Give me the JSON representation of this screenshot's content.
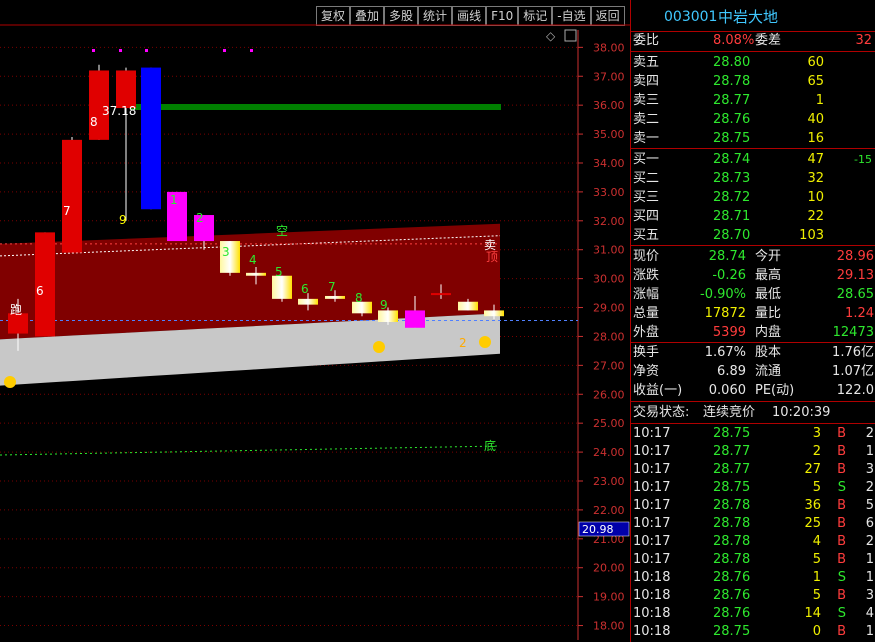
{
  "toolbar": [
    "复权",
    "叠加",
    "多股",
    "统计",
    "画线",
    "F10",
    "标记",
    "-自选",
    "返回"
  ],
  "stock": {
    "code": "003001",
    "name": "中岩大地"
  },
  "chart_data": {
    "type": "candlestick",
    "y_axis_ticks": [
      "38.00",
      "37.00",
      "36.00",
      "35.00",
      "34.00",
      "33.00",
      "32.00",
      "31.00",
      "30.00",
      "29.00",
      "28.00",
      "27.00",
      "26.00",
      "25.00",
      "24.00",
      "23.00",
      "22.00",
      "21.00",
      "20.00",
      "19.00",
      "18.00"
    ],
    "ylim": [
      17.5,
      38.6
    ],
    "candles": [
      {
        "o": 28.1,
        "h": 29.3,
        "l": 27.5,
        "c": 28.8,
        "color": "red"
      },
      {
        "o": 28.0,
        "h": 31.6,
        "l": 28.0,
        "c": 31.6,
        "color": "red"
      },
      {
        "o": 30.9,
        "h": 34.9,
        "l": 30.9,
        "c": 34.8,
        "color": "red"
      },
      {
        "o": 34.8,
        "h": 37.4,
        "l": 34.8,
        "c": 37.2,
        "color": "red"
      },
      {
        "o": 37.2,
        "h": 37.3,
        "l": 32.0,
        "c": 35.9,
        "color": "red"
      },
      {
        "o": 37.3,
        "h": 37.3,
        "l": 32.4,
        "c": 32.4,
        "color": "blue"
      },
      {
        "o": 33.0,
        "h": 33.0,
        "l": 31.3,
        "c": 31.3,
        "color": "magenta"
      },
      {
        "o": 32.2,
        "h": 32.2,
        "l": 31.0,
        "c": 31.3,
        "color": "magenta"
      },
      {
        "o": 31.3,
        "h": 31.3,
        "l": 30.1,
        "c": 30.2,
        "color": "yellow"
      },
      {
        "o": 30.2,
        "h": 30.4,
        "l": 29.8,
        "c": 30.1,
        "color": "yellow"
      },
      {
        "o": 30.1,
        "h": 30.1,
        "l": 29.2,
        "c": 29.3,
        "color": "yellow"
      },
      {
        "o": 29.3,
        "h": 29.5,
        "l": 28.9,
        "c": 29.1,
        "color": "yellow"
      },
      {
        "o": 29.3,
        "h": 29.6,
        "l": 29.2,
        "c": 29.4,
        "color": "yellow"
      },
      {
        "o": 29.2,
        "h": 29.2,
        "l": 28.7,
        "c": 28.8,
        "color": "yellow"
      },
      {
        "o": 28.9,
        "h": 29.0,
        "l": 28.4,
        "c": 28.5,
        "color": "yellow"
      },
      {
        "o": 28.3,
        "h": 29.4,
        "l": 28.3,
        "c": 28.9,
        "color": "magenta"
      },
      {
        "o": 29.5,
        "h": 29.8,
        "l": 29.3,
        "c": 29.5,
        "color": "red"
      },
      {
        "o": 29.2,
        "h": 29.3,
        "l": 28.9,
        "c": 28.9,
        "color": "yellow"
      },
      {
        "o": 28.9,
        "h": 29.1,
        "l": 28.6,
        "c": 28.7,
        "color": "yellow"
      }
    ],
    "annotations": [
      "跑",
      "6",
      "7",
      "8",
      "37.18",
      "9",
      "1",
      "2",
      "3",
      "4",
      "5",
      "6",
      "7",
      "8",
      "9",
      "空",
      "卖",
      "顶",
      "2",
      "底"
    ],
    "price_label": "20.98"
  },
  "quote": {
    "weibi_label": "委比",
    "weibi": "8.08%",
    "weicha_label": "委差",
    "weicha": "32",
    "sells": [
      {
        "label": "卖五",
        "price": "28.80",
        "vol": "60"
      },
      {
        "label": "卖四",
        "price": "28.78",
        "vol": "65"
      },
      {
        "label": "卖三",
        "price": "28.77",
        "vol": "1"
      },
      {
        "label": "卖二",
        "price": "28.76",
        "vol": "40"
      },
      {
        "label": "卖一",
        "price": "28.75",
        "vol": "16"
      }
    ],
    "buys": [
      {
        "label": "买一",
        "price": "28.74",
        "vol": "47",
        "chg": "-15"
      },
      {
        "label": "买二",
        "price": "28.73",
        "vol": "32"
      },
      {
        "label": "买三",
        "price": "28.72",
        "vol": "10"
      },
      {
        "label": "买四",
        "price": "28.71",
        "vol": "22"
      },
      {
        "label": "买五",
        "price": "28.70",
        "vol": "103"
      }
    ],
    "stats": [
      {
        "l1": "现价",
        "v1": "28.74",
        "l2": "今开",
        "v2": "28.96",
        "c1": "green",
        "c2": "red"
      },
      {
        "l1": "涨跌",
        "v1": "-0.26",
        "l2": "最高",
        "v2": "29.13",
        "c1": "green",
        "c2": "red"
      },
      {
        "l1": "涨幅",
        "v1": "-0.90%",
        "l2": "最低",
        "v2": "28.65",
        "c1": "green",
        "c2": "green"
      },
      {
        "l1": "总量",
        "v1": "17872",
        "l2": "量比",
        "v2": "1.24",
        "c1": "yellow",
        "c2": "red"
      },
      {
        "l1": "外盘",
        "v1": "5399",
        "l2": "内盘",
        "v2": "12473",
        "c1": "red",
        "c2": "green"
      }
    ],
    "stats2": [
      {
        "l1": "换手",
        "v1": "1.67%",
        "l2": "股本",
        "v2": "1.76亿"
      },
      {
        "l1": "净资",
        "v1": "6.89",
        "l2": "流通",
        "v2": "1.07亿"
      },
      {
        "l1": "收益(一)",
        "v1": "0.060",
        "l2": "PE(动)",
        "v2": "122.0"
      }
    ],
    "status_label": "交易状态:",
    "status": "连续竞价",
    "status_time": "10:20:39"
  },
  "ticks": [
    {
      "t": "10:17",
      "p": "28.75",
      "v": "3",
      "d": "B",
      "n": "2"
    },
    {
      "t": "10:17",
      "p": "28.77",
      "v": "2",
      "d": "B",
      "n": "1"
    },
    {
      "t": "10:17",
      "p": "28.77",
      "v": "27",
      "d": "B",
      "n": "3"
    },
    {
      "t": "10:17",
      "p": "28.75",
      "v": "5",
      "d": "S",
      "n": "2"
    },
    {
      "t": "10:17",
      "p": "28.78",
      "v": "36",
      "d": "B",
      "n": "5"
    },
    {
      "t": "10:17",
      "p": "28.78",
      "v": "25",
      "d": "B",
      "n": "6"
    },
    {
      "t": "10:17",
      "p": "28.78",
      "v": "4",
      "d": "B",
      "n": "2"
    },
    {
      "t": "10:17",
      "p": "28.78",
      "v": "5",
      "d": "B",
      "n": "1"
    },
    {
      "t": "10:18",
      "p": "28.76",
      "v": "1",
      "d": "S",
      "n": "1"
    },
    {
      "t": "10:18",
      "p": "28.76",
      "v": "5",
      "d": "B",
      "n": "3"
    },
    {
      "t": "10:18",
      "p": "28.76",
      "v": "14",
      "d": "S",
      "n": "4"
    },
    {
      "t": "10:18",
      "p": "28.75",
      "v": "0",
      "d": "B",
      "n": "1"
    }
  ],
  "colors": {
    "up": "#ff2020",
    "down": "#2ee82e",
    "band": "#800000",
    "floor": "#c8c8c8",
    "grid": "#7a0000",
    "accent": "#40c8ff"
  }
}
